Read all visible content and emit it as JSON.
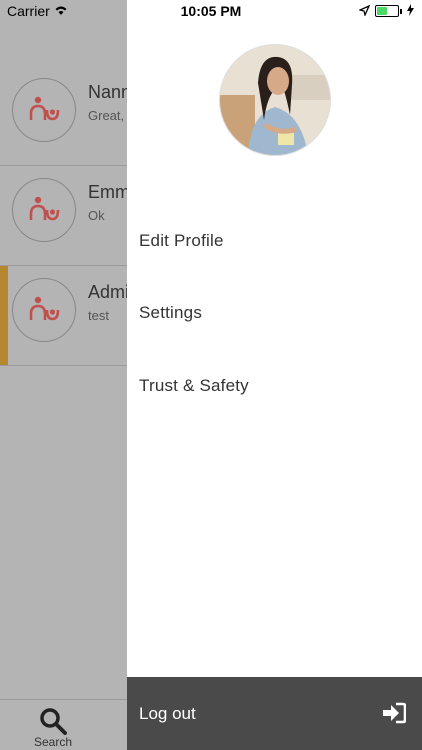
{
  "status_bar": {
    "carrier": "Carrier",
    "time": "10:05 PM",
    "battery_level": 0.5
  },
  "chats": [
    {
      "name": "Nanny",
      "message": "Great,"
    },
    {
      "name": "Emma",
      "message": "Ok"
    },
    {
      "name": "Admin",
      "message": "test"
    }
  ],
  "tabbar": {
    "search_label": "Search"
  },
  "drawer": {
    "menu": [
      {
        "label": "Edit Profile"
      },
      {
        "label": "Settings"
      },
      {
        "label": "Trust & Safety"
      }
    ],
    "logout_label": "Log out"
  },
  "colors": {
    "accent": "#b5872f",
    "logo": "#c0504d",
    "drawer_footer": "#4a4a4a",
    "dim": "#b4b4b4"
  }
}
